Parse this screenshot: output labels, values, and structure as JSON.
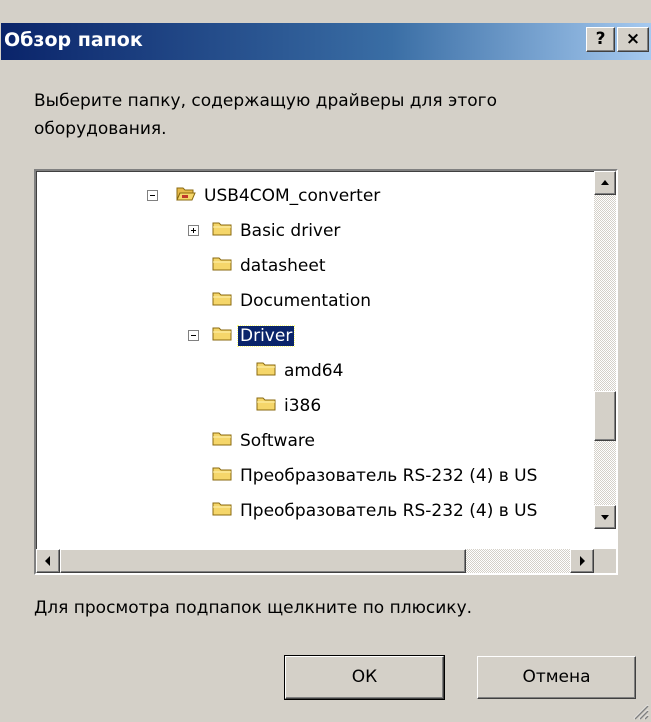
{
  "dialog": {
    "title": "Обзор папок",
    "help_button": "?",
    "close_button": "×",
    "prompt": "Выберите папку, содержащую драйверы для этого оборудования.",
    "hint": "Для просмотра подпапок щелкните по плюсику.",
    "ok_label": "ОК",
    "cancel_label": "Отмена"
  },
  "tree": {
    "items": [
      {
        "label": "USB4COM_converter",
        "expander": "minus",
        "icon": "open-folder-icon",
        "selected": false
      },
      {
        "label": "Basic driver",
        "expander": "plus",
        "icon": "folder-icon",
        "selected": false
      },
      {
        "label": "datasheet",
        "expander": "none",
        "icon": "folder-icon",
        "selected": false
      },
      {
        "label": "Documentation",
        "expander": "none",
        "icon": "folder-icon",
        "selected": false
      },
      {
        "label": "Driver",
        "expander": "minus",
        "icon": "folder-icon",
        "selected": true
      },
      {
        "label": "amd64",
        "expander": "none",
        "icon": "folder-icon",
        "selected": false
      },
      {
        "label": "i386",
        "expander": "none",
        "icon": "folder-icon",
        "selected": false
      },
      {
        "label": "Software",
        "expander": "none",
        "icon": "folder-icon",
        "selected": false
      },
      {
        "label": "Преобразователь RS-232 (4) в US",
        "expander": "none",
        "icon": "folder-icon",
        "selected": false
      },
      {
        "label": "Преобразователь RS-232 (4) в US",
        "expander": "none",
        "icon": "folder-icon",
        "selected": false
      }
    ]
  },
  "colors": {
    "titlebar_start": "#0a246a",
    "titlebar_end": "#a6caf0",
    "dialog_bg": "#d4d0c8",
    "selection_bg": "#0a246a",
    "folder_yellow": "#f5d66a"
  }
}
